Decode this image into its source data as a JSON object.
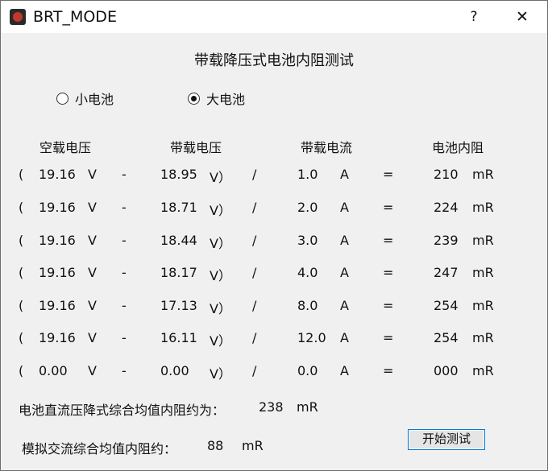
{
  "window": {
    "title": "BRT_MODE",
    "help_label": "?",
    "close_label": "✕"
  },
  "heading": "带载降压式电池内阻测试",
  "battery_options": [
    {
      "label": "小电池",
      "selected": false
    },
    {
      "label": "大电池",
      "selected": true
    }
  ],
  "columns": [
    "空载电压",
    "带载电压",
    "带载电流",
    "电池内阻"
  ],
  "symbols": {
    "open_paren": "(",
    "volt_unit_open": "V",
    "minus": "-",
    "volt_unit_close": "V）",
    "divide": "/",
    "amp_unit": "A",
    "equals": "=",
    "res_unit": "mR"
  },
  "rows": [
    {
      "v_open": "19.16",
      "v_load": "18.95",
      "i_load": "1.0",
      "r": "210"
    },
    {
      "v_open": "19.16",
      "v_load": "18.71",
      "i_load": "2.0",
      "r": "224"
    },
    {
      "v_open": "19.16",
      "v_load": "18.44",
      "i_load": "3.0",
      "r": "239"
    },
    {
      "v_open": "19.16",
      "v_load": "18.17",
      "i_load": "4.0",
      "r": "247"
    },
    {
      "v_open": "19.16",
      "v_load": "17.13",
      "i_load": "8.0",
      "r": "254"
    },
    {
      "v_open": "19.16",
      "v_load": "16.11",
      "i_load": "12.0",
      "r": "254"
    },
    {
      "v_open": "0.00",
      "v_load": "0.00",
      "i_load": "0.0",
      "r": "000"
    }
  ],
  "dc_result": {
    "label": "电池直流压降式综合均值内阻约为：",
    "value": "238",
    "unit": "mR"
  },
  "ac_result": {
    "label": "模拟交流综合均值内阻约：",
    "value": "88",
    "unit": "mR"
  },
  "start_button": "开始测试"
}
